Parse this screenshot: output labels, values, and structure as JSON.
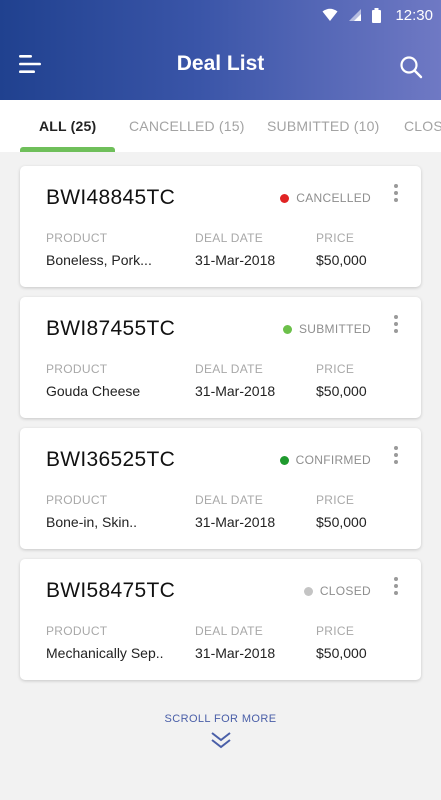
{
  "status_bar": {
    "time": "12:30"
  },
  "header": {
    "title": "Deal List"
  },
  "tabs": [
    {
      "label": "ALL (25)",
      "active": true
    },
    {
      "label": "CANCELLED (15)",
      "active": false
    },
    {
      "label": "SUBMITTED (10)",
      "active": false
    },
    {
      "label": "CLOS",
      "active": false
    }
  ],
  "column_labels": {
    "product": "PRODUCT",
    "deal_date": "DEAL DATE",
    "price": "PRICE"
  },
  "deals": [
    {
      "id": "BWI48845TC",
      "status": "CANCELLED",
      "status_color": "#e02424",
      "product": "Boneless, Pork...",
      "deal_date": "31-Mar-2018",
      "price": "$50,000"
    },
    {
      "id": "BWI87455TC",
      "status": "SUBMITTED",
      "status_color": "#6cc04a",
      "product": "Gouda Cheese",
      "deal_date": "31-Mar-2018",
      "price": "$50,000"
    },
    {
      "id": "BWI36525TC",
      "status": "CONFIRMED",
      "status_color": "#1f9a2e",
      "product": "Bone-in, Skin..",
      "deal_date": "31-Mar-2018",
      "price": "$50,000"
    },
    {
      "id": "BWI58475TC",
      "status": "CLOSED",
      "status_color": "#c4c4c4",
      "product": "Mechanically Sep..",
      "deal_date": "31-Mar-2018",
      "price": "$50,000"
    }
  ],
  "footer": {
    "scroll_label": "SCROLL FOR MORE"
  }
}
